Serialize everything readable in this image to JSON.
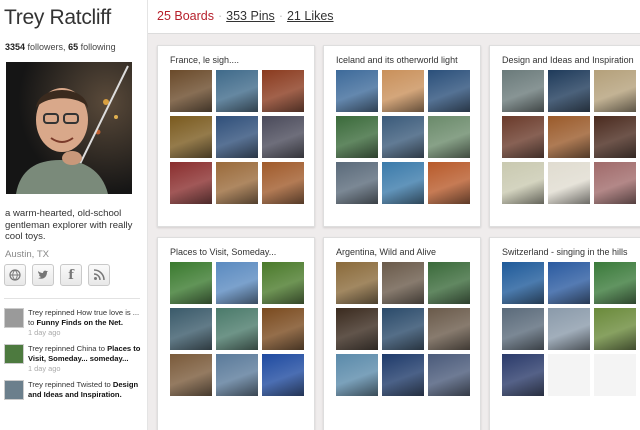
{
  "profile": {
    "name": "Trey Ratcliff",
    "followers_count": "3354",
    "followers_label": "followers,",
    "following_count": "65",
    "following_label": "following",
    "bio": "a warm-hearted, old-school gentleman explorer with really cool toys.",
    "location": "Austin, TX",
    "social_icons": [
      "website-icon",
      "twitter-icon",
      "facebook-icon",
      "rss-icon"
    ]
  },
  "activity": [
    {
      "pre": "Trey repinned How true love is ... to ",
      "board": "Funny Finds on the Net.",
      "time": "1 day ago",
      "color": "#9a9a9a"
    },
    {
      "pre": "Trey repinned China to ",
      "board": "Places to Visit, Someday... someday...",
      "time": "1 day ago",
      "color": "#4d7a3f"
    },
    {
      "pre": "Trey repinned Twisted to ",
      "board": "Design and Ideas and Inspiration.",
      "time": "",
      "color": "#6b7f8c"
    }
  ],
  "header": {
    "boards": "25 Boards",
    "pins": "353 Pins",
    "likes": "21 Likes",
    "sep": "·",
    "accent": "#b61f2b"
  },
  "boards": [
    {
      "title": "France, le sigh....",
      "thumbs": [
        "#6a4a2a",
        "#3f6a8a",
        "#8a3a1e",
        "#7a5a1e",
        "#2f4f7a",
        "#4a4a5a",
        "#8a2e2e",
        "#9a6a3a",
        "#a05a2a"
      ]
    },
    {
      "title": "Iceland and its otherworld light",
      "thumbs": [
        "#3d6a9a",
        "#c9905a",
        "#2a4f7a",
        "#3a6a3a",
        "#3a5a7a",
        "#6a8a6a",
        "#5a6a7a",
        "#3a7aaa",
        "#b85a2a"
      ]
    },
    {
      "title": "Design and Ideas and Inspiration",
      "thumbs": [
        "#6a7a7a",
        "#1e3a5a",
        "#b4a07a",
        "#6a3a2a",
        "#9a5a2a",
        "#4a2a1e",
        "#c9c9b0",
        "#e0dcd0",
        "#a06a6a"
      ]
    },
    {
      "title": "Places to Visit, Someday...",
      "thumbs": [
        "#3a7a2e",
        "#5a8ac0",
        "#4a7a2a",
        "#3a5a6a",
        "#4a7a6a",
        "#7a4a1e",
        "#7a5a3a",
        "#5a7a9a",
        "#1e4aa0"
      ]
    },
    {
      "title": "Argentina, Wild and Alive",
      "thumbs": [
        "#8a6a3a",
        "#6a5a4a",
        "#3a6a3a",
        "#3a2a1e",
        "#2a4a6a",
        "#6a5a4a",
        "#5a8aaa",
        "#1e3a6a",
        "#4a5a7a"
      ]
    },
    {
      "title": "Switzerland - singing in the hills",
      "thumbs": [
        "#1e5a9a",
        "#2a5aa0",
        "#3a7a3a",
        "#5a6a7a",
        "#8a9aaa",
        "#6a8a3a",
        "#2a3a6a"
      ]
    }
  ]
}
